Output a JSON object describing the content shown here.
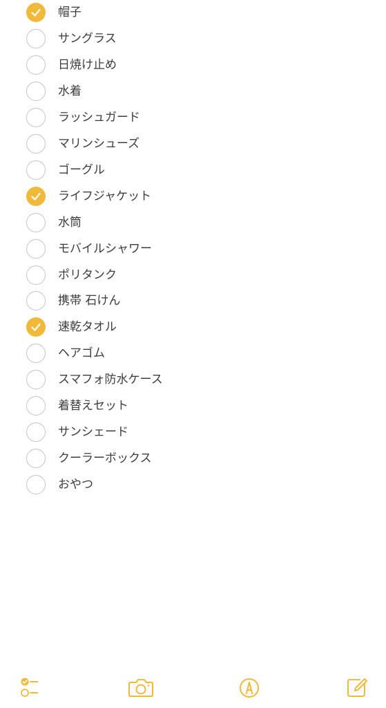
{
  "checklist": {
    "items": [
      {
        "label": "帽子",
        "checked": true
      },
      {
        "label": "サングラス",
        "checked": false
      },
      {
        "label": "日焼け止め",
        "checked": false
      },
      {
        "label": "水着",
        "checked": false
      },
      {
        "label": "ラッシュガード",
        "checked": false
      },
      {
        "label": "マリンシューズ",
        "checked": false
      },
      {
        "label": "ゴーグル",
        "checked": false
      },
      {
        "label": "ライフジャケット",
        "checked": true
      },
      {
        "label": "水筒",
        "checked": false
      },
      {
        "label": "モバイルシャワー",
        "checked": false
      },
      {
        "label": "ポリタンク",
        "checked": false
      },
      {
        "label": "携帯 石けん",
        "checked": false
      },
      {
        "label": "速乾タオル",
        "checked": true
      },
      {
        "label": "ヘアゴム",
        "checked": false
      },
      {
        "label": "スマフォ防水ケース",
        "checked": false
      },
      {
        "label": "着替えセット",
        "checked": false
      },
      {
        "label": "サンシェード",
        "checked": false
      },
      {
        "label": "クーラーボックス",
        "checked": false
      },
      {
        "label": "おやつ",
        "checked": false
      }
    ]
  },
  "toolbar": {
    "buttons": [
      {
        "icon": "checklist-icon"
      },
      {
        "icon": "camera-icon"
      },
      {
        "icon": "markup-pen-icon"
      },
      {
        "icon": "compose-icon"
      }
    ]
  },
  "colors": {
    "accent": "#f0b93a",
    "unchecked_border": "#c4c4c6",
    "text": "#3c3c3e"
  }
}
